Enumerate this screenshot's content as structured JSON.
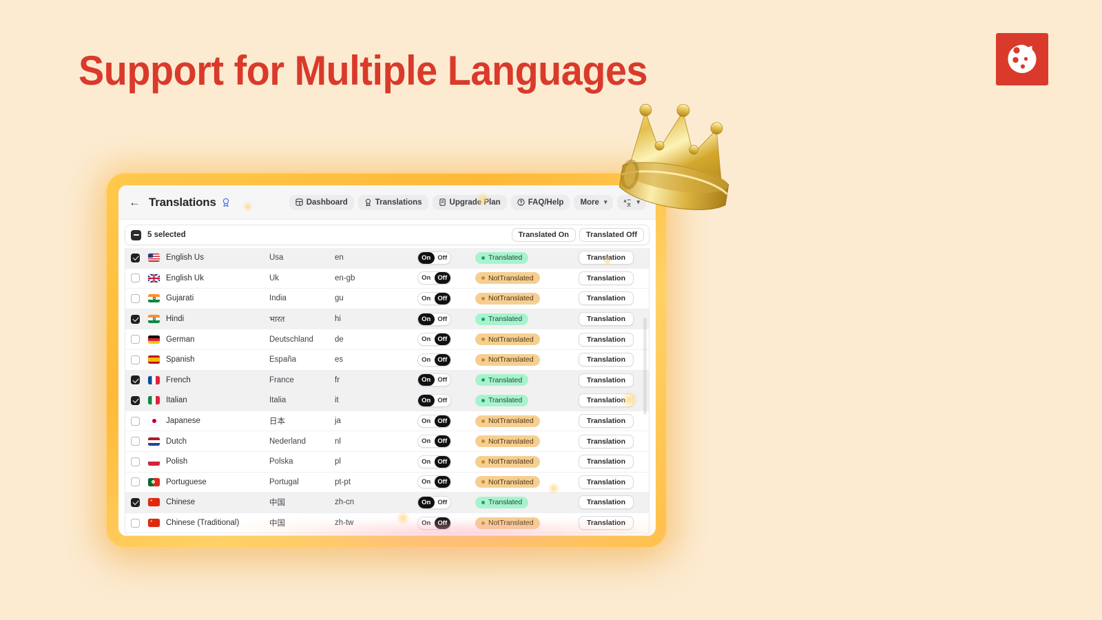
{
  "page": {
    "title": "Support for Multiple Languages",
    "background_color": "#fcebd0",
    "title_color": "#d93a2b"
  },
  "logo": {
    "name": "cookie-logo",
    "background_color": "#d93a2b"
  },
  "decoration": {
    "crown": "gold-crown"
  },
  "app": {
    "header": {
      "back_label": "←",
      "title": "Translations",
      "title_icon": "badge-icon",
      "nav": [
        {
          "label": "Dashboard",
          "icon": "dashboard-icon"
        },
        {
          "label": "Translations",
          "icon": "badge-icon"
        },
        {
          "label": "Upgrade Plan",
          "icon": "upgrade-icon"
        },
        {
          "label": "FAQ/Help",
          "icon": "question-circle-icon"
        },
        {
          "label": "More",
          "icon": "chevron-down-icon"
        },
        {
          "label": "",
          "icon": "translate-icon"
        }
      ]
    },
    "toolbar": {
      "selected_label": "5 selected",
      "filters": [
        "Translated On",
        "Translated Off"
      ]
    },
    "table": {
      "action_label": "Translation",
      "toggle_on": "On",
      "toggle_off": "Off",
      "status_translated": "Translated",
      "status_not_translated": "NotTranslated",
      "rows": [
        {
          "checked": true,
          "flag": "us",
          "name": "English Us",
          "native": "Usa",
          "code": "en",
          "toggle": "On",
          "status": "Translated"
        },
        {
          "checked": false,
          "flag": "gb",
          "name": "English Uk",
          "native": "Uk",
          "code": "en-gb",
          "toggle": "Off",
          "status": "NotTranslated"
        },
        {
          "checked": false,
          "flag": "in",
          "name": "Gujarati",
          "native": "India",
          "code": "gu",
          "toggle": "Off",
          "status": "NotTranslated"
        },
        {
          "checked": true,
          "flag": "in",
          "name": "Hindi",
          "native": "भारत",
          "code": "hi",
          "toggle": "On",
          "status": "Translated"
        },
        {
          "checked": false,
          "flag": "de",
          "name": "German",
          "native": "Deutschland",
          "code": "de",
          "toggle": "Off",
          "status": "NotTranslated"
        },
        {
          "checked": false,
          "flag": "es",
          "name": "Spanish",
          "native": "España",
          "code": "es",
          "toggle": "Off",
          "status": "NotTranslated"
        },
        {
          "checked": true,
          "flag": "fr",
          "name": "French",
          "native": "France",
          "code": "fr",
          "toggle": "On",
          "status": "Translated"
        },
        {
          "checked": true,
          "flag": "it",
          "name": "Italian",
          "native": "Italia",
          "code": "it",
          "toggle": "On",
          "status": "Translated"
        },
        {
          "checked": false,
          "flag": "jp",
          "name": "Japanese",
          "native": "日本",
          "code": "ja",
          "toggle": "Off",
          "status": "NotTranslated"
        },
        {
          "checked": false,
          "flag": "nl",
          "name": "Dutch",
          "native": "Nederland",
          "code": "nl",
          "toggle": "Off",
          "status": "NotTranslated"
        },
        {
          "checked": false,
          "flag": "pl",
          "name": "Polish",
          "native": "Polska",
          "code": "pl",
          "toggle": "Off",
          "status": "NotTranslated"
        },
        {
          "checked": false,
          "flag": "pt",
          "name": "Portuguese",
          "native": "Portugal",
          "code": "pt-pt",
          "toggle": "Off",
          "status": "NotTranslated"
        },
        {
          "checked": true,
          "flag": "cn",
          "name": "Chinese",
          "native": "中国",
          "code": "zh-cn",
          "toggle": "On",
          "status": "Translated"
        },
        {
          "checked": false,
          "flag": "cn",
          "name": "Chinese (Traditional)",
          "native": "中国",
          "code": "zh-tw",
          "toggle": "Off",
          "status": "NotTranslated"
        }
      ]
    }
  }
}
